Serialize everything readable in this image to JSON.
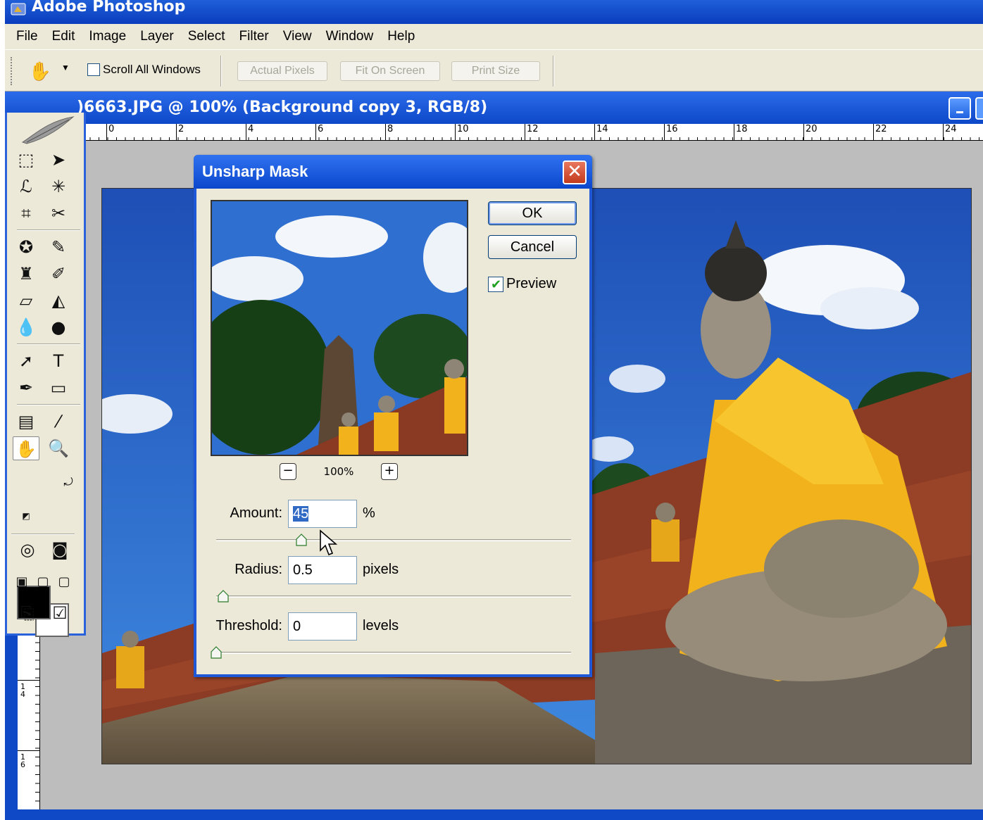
{
  "app": {
    "title": "Adobe Photoshop"
  },
  "menu": [
    "File",
    "Edit",
    "Image",
    "Layer",
    "Select",
    "Filter",
    "View",
    "Window",
    "Help"
  ],
  "options_bar": {
    "scroll_all_windows_label": "Scroll All Windows",
    "scroll_all_windows_checked": false,
    "buttons": [
      "Actual Pixels",
      "Fit On Screen",
      "Print Size"
    ]
  },
  "document": {
    "title": ")6663.JPG @ 100% (Background copy 3, RGB/8)",
    "ruler_h_labels": [
      "0",
      "2",
      "4",
      "6",
      "8",
      "10",
      "12",
      "14",
      "16",
      "18",
      "20",
      "22",
      "24"
    ],
    "ruler_v_labels": [
      "14",
      "16"
    ]
  },
  "dialog": {
    "title": "Unsharp Mask",
    "ok_label": "OK",
    "cancel_label": "Cancel",
    "preview_label": "Preview",
    "preview_checked": true,
    "zoom_minus": "−",
    "zoom_plus": "+",
    "zoom_value": "100%",
    "amount": {
      "label": "Amount:",
      "value": "45",
      "unit": "%",
      "slider_fraction": 0.24
    },
    "radius": {
      "label": "Radius:",
      "value": "0.5",
      "unit": "pixels",
      "slider_fraction": 0.02
    },
    "threshold": {
      "label": "Threshold:",
      "value": "0",
      "unit": "levels",
      "slider_fraction": 0.0
    }
  },
  "colors": {
    "xp_blue": "#0a3dbd",
    "dialog_face": "#ece9d8",
    "sky": "#2f6fd0",
    "robe": "#f2b21b"
  }
}
